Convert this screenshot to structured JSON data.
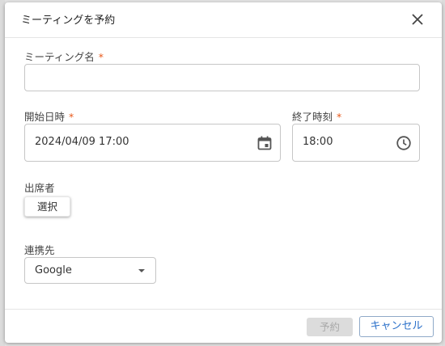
{
  "dialog": {
    "title": "ミーティングを予約",
    "close_icon": "close-icon"
  },
  "form": {
    "meeting_name": {
      "label": "ミーティング名",
      "required_mark": "*",
      "value": ""
    },
    "start": {
      "label": "開始日時",
      "required_mark": "*",
      "value": "2024/04/09 17:00",
      "icon": "calendar-icon"
    },
    "end": {
      "label": "終了時刻",
      "required_mark": "*",
      "value": "18:00",
      "icon": "clock-icon"
    },
    "attendees": {
      "label": "出席者",
      "button_label": "選択"
    },
    "integration": {
      "label": "連携先",
      "selected": "Google",
      "icon": "caret-down-icon"
    }
  },
  "footer": {
    "reserve_label": "予約",
    "cancel_label": "キャンセル"
  },
  "colors": {
    "required": "#e8591a",
    "cancel_text": "#2a6fc9",
    "disabled_bg": "#dcdcdc"
  }
}
